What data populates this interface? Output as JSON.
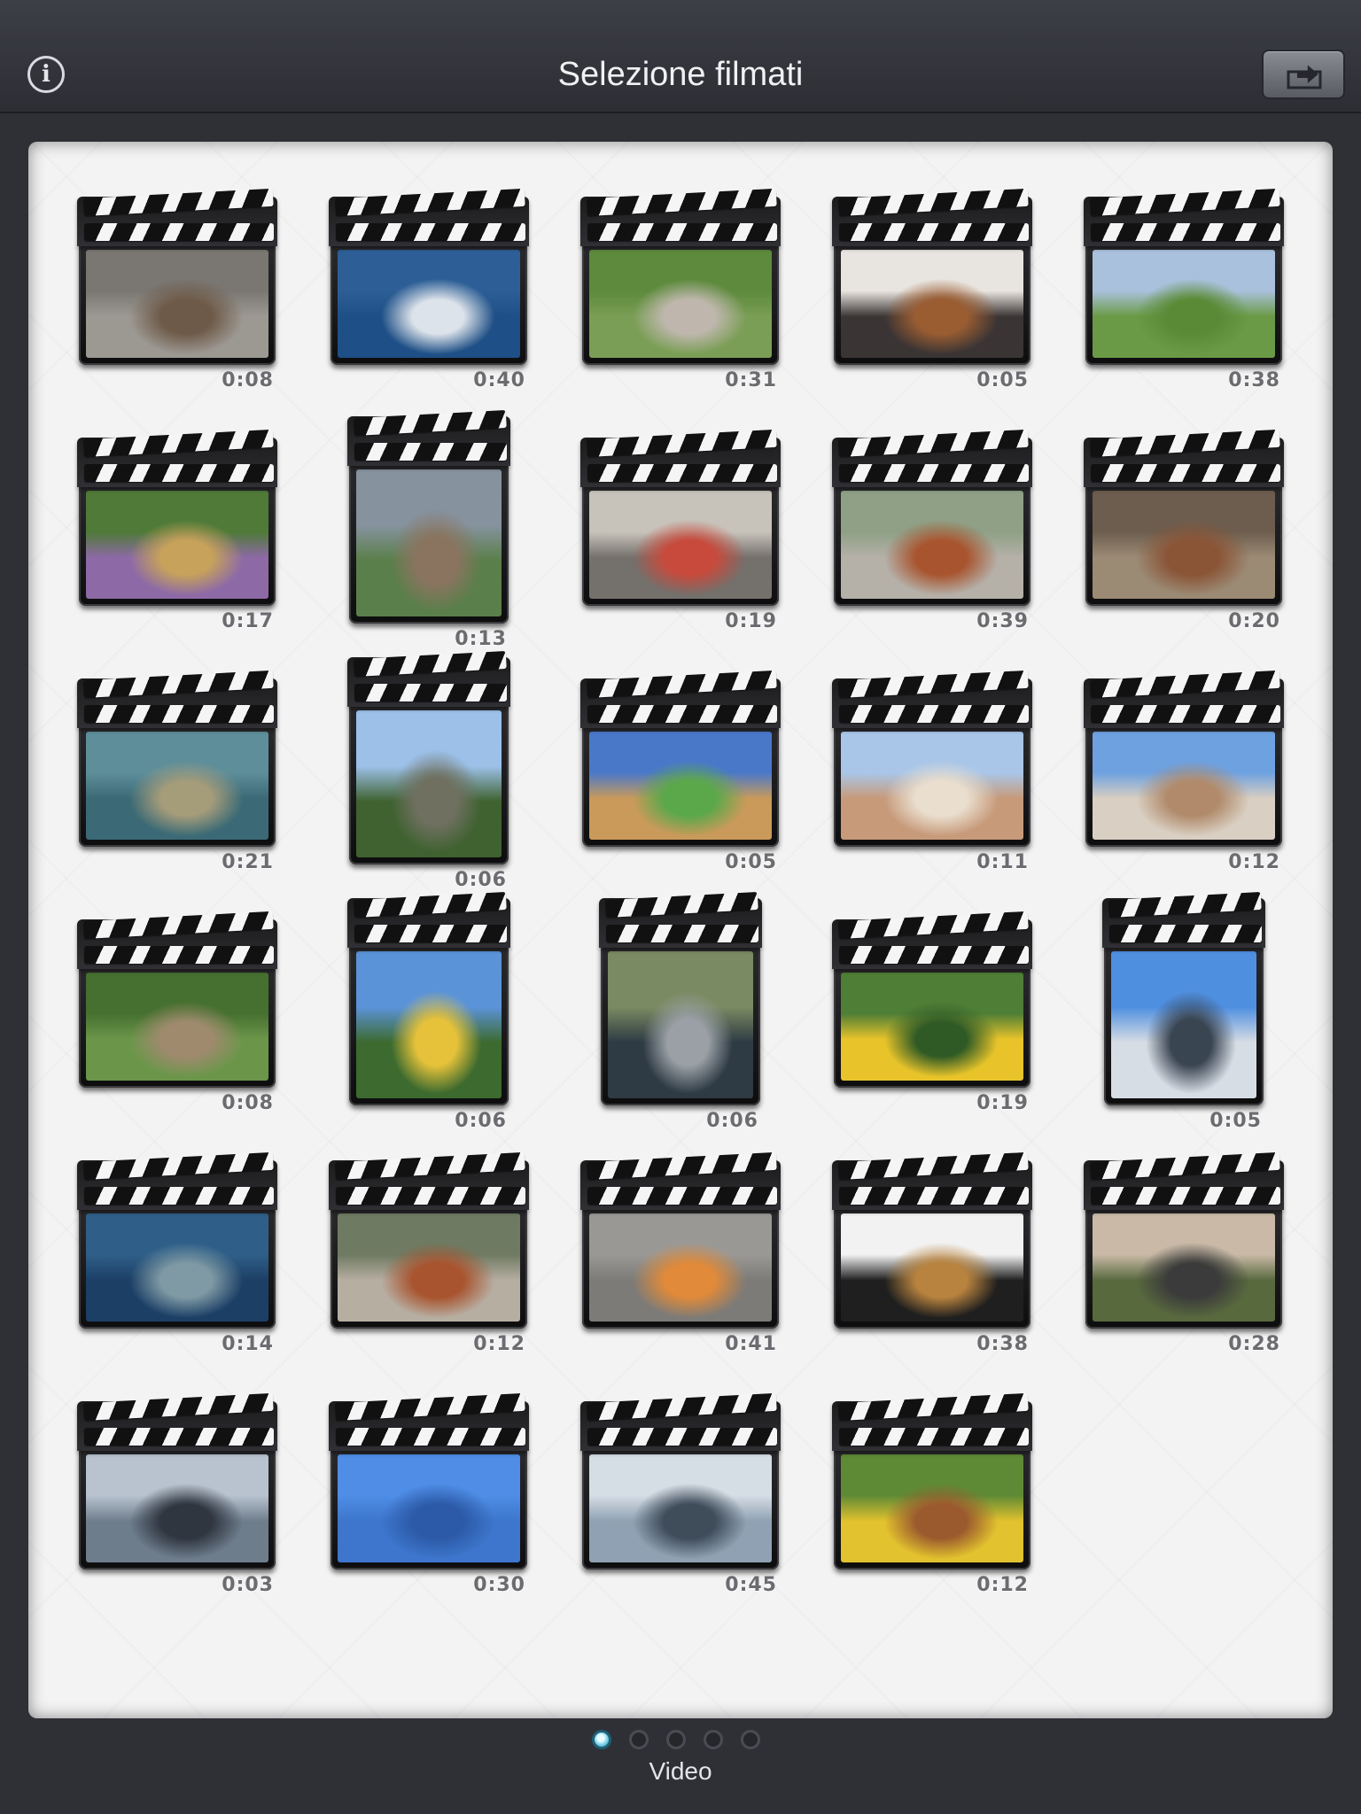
{
  "header": {
    "title": "Selezione filmati",
    "info_label": "i"
  },
  "clips": [
    {
      "duration": "0:08",
      "subject": "boxer puppy sitting",
      "colors": [
        "#7a7671",
        "#9c9892",
        "#6e5a48"
      ]
    },
    {
      "duration": "0:40",
      "subject": "blue sea with boats",
      "colors": [
        "#2d5f96",
        "#1e4f86",
        "#dde3ea"
      ]
    },
    {
      "duration": "0:31",
      "subject": "group picnic on grass",
      "colors": [
        "#5d8a3c",
        "#7a9e55",
        "#bfb7ad"
      ]
    },
    {
      "duration": "0:05",
      "subject": "puppies in dog bed",
      "colors": [
        "#e8e4df",
        "#3a3434",
        "#9a5d32"
      ]
    },
    {
      "duration": "0:38",
      "subject": "football on green field",
      "colors": [
        "#a9c1dc",
        "#6a9a45",
        "#5b8a36"
      ]
    },
    {
      "duration": "0:17",
      "subject": "butterfly on flowers",
      "colors": [
        "#4f7a38",
        "#8d6aa6",
        "#c7a25a"
      ]
    },
    {
      "duration": "0:13",
      "subject": "race track with red car",
      "colors": [
        "#86929e",
        "#5a7f4a",
        "#8a7460"
      ]
    },
    {
      "duration": "0:19",
      "subject": "kids on gravel beach",
      "colors": [
        "#c7c2ba",
        "#74706c",
        "#c74a3c"
      ]
    },
    {
      "duration": "0:39",
      "subject": "red panda on rocks",
      "colors": [
        "#8fa086",
        "#b5b0a8",
        "#a8542e"
      ]
    },
    {
      "duration": "0:20",
      "subject": "bird on ground",
      "colors": [
        "#6d5d4e",
        "#9b8a74",
        "#8a5436"
      ]
    },
    {
      "duration": "0:21",
      "subject": "fish in aquarium",
      "colors": [
        "#5e8e9a",
        "#3b6a76",
        "#a59c7a"
      ]
    },
    {
      "duration": "0:06",
      "subject": "trees and street",
      "colors": [
        "#9cc0e8",
        "#3f6230",
        "#6f7060"
      ]
    },
    {
      "duration": "0:05",
      "subject": "prairie dog close-up",
      "colors": [
        "#4a78c9",
        "#c99a5a",
        "#5aa84a"
      ]
    },
    {
      "duration": "0:11",
      "subject": "town rooftops",
      "colors": [
        "#a9c6e8",
        "#c79a7a",
        "#eadfcf"
      ]
    },
    {
      "duration": "0:12",
      "subject": "town panorama",
      "colors": [
        "#6ea1e0",
        "#d9cfc2",
        "#b08a6a"
      ]
    },
    {
      "duration": "0:08",
      "subject": "green plants",
      "colors": [
        "#46702f",
        "#6b964a",
        "#9f8a6e"
      ]
    },
    {
      "duration": "0:06",
      "subject": "palm trees and building",
      "colors": [
        "#5b93d8",
        "#3c6a2f",
        "#e6c23a"
      ]
    },
    {
      "duration": "0:06",
      "subject": "car on road",
      "colors": [
        "#7a8a62",
        "#2e3a44",
        "#9aa0a6"
      ]
    },
    {
      "duration": "0:19",
      "subject": "butterfly on yellow flowers",
      "colors": [
        "#4f7e36",
        "#e8c42a",
        "#2f5a26"
      ]
    },
    {
      "duration": "0:05",
      "subject": "parking lot and building",
      "colors": [
        "#4f8fe0",
        "#d7dde5",
        "#3a4552"
      ]
    },
    {
      "duration": "0:14",
      "subject": "sea turtle underwater",
      "colors": [
        "#2f5f88",
        "#1c3f66",
        "#7f9aa4"
      ]
    },
    {
      "duration": "0:12",
      "subject": "red panda among rocks",
      "colors": [
        "#6f7a62",
        "#b7aea2",
        "#a8542e"
      ]
    },
    {
      "duration": "0:41",
      "subject": "kids playing in street",
      "colors": [
        "#9a9894",
        "#7d7b77",
        "#e08a3a"
      ]
    },
    {
      "duration": "0:38",
      "subject": "origami swan and box",
      "colors": [
        "#f2f2f2",
        "#1f1f1f",
        "#b8833e"
      ]
    },
    {
      "duration": "0:28",
      "subject": "balcony with plants",
      "colors": [
        "#c9b9a6",
        "#58693e",
        "#3b3b3b"
      ]
    },
    {
      "duration": "0:03",
      "subject": "sea at dusk",
      "colors": [
        "#b8c3cf",
        "#6e7d8c",
        "#2f3640"
      ]
    },
    {
      "duration": "0:30",
      "subject": "sleeping dog blue tint",
      "colors": [
        "#4f8de6",
        "#3d76cc",
        "#2c5aa8"
      ]
    },
    {
      "duration": "0:45",
      "subject": "swans on lake",
      "colors": [
        "#d5dde5",
        "#8fa1b2",
        "#3f4c5a"
      ]
    },
    {
      "duration": "0:12",
      "subject": "puppies in flowers",
      "colors": [
        "#5f8a35",
        "#e2c22e",
        "#9b5a2e"
      ]
    }
  ],
  "pager": {
    "label": "Video",
    "pages": 5,
    "active": 1
  }
}
